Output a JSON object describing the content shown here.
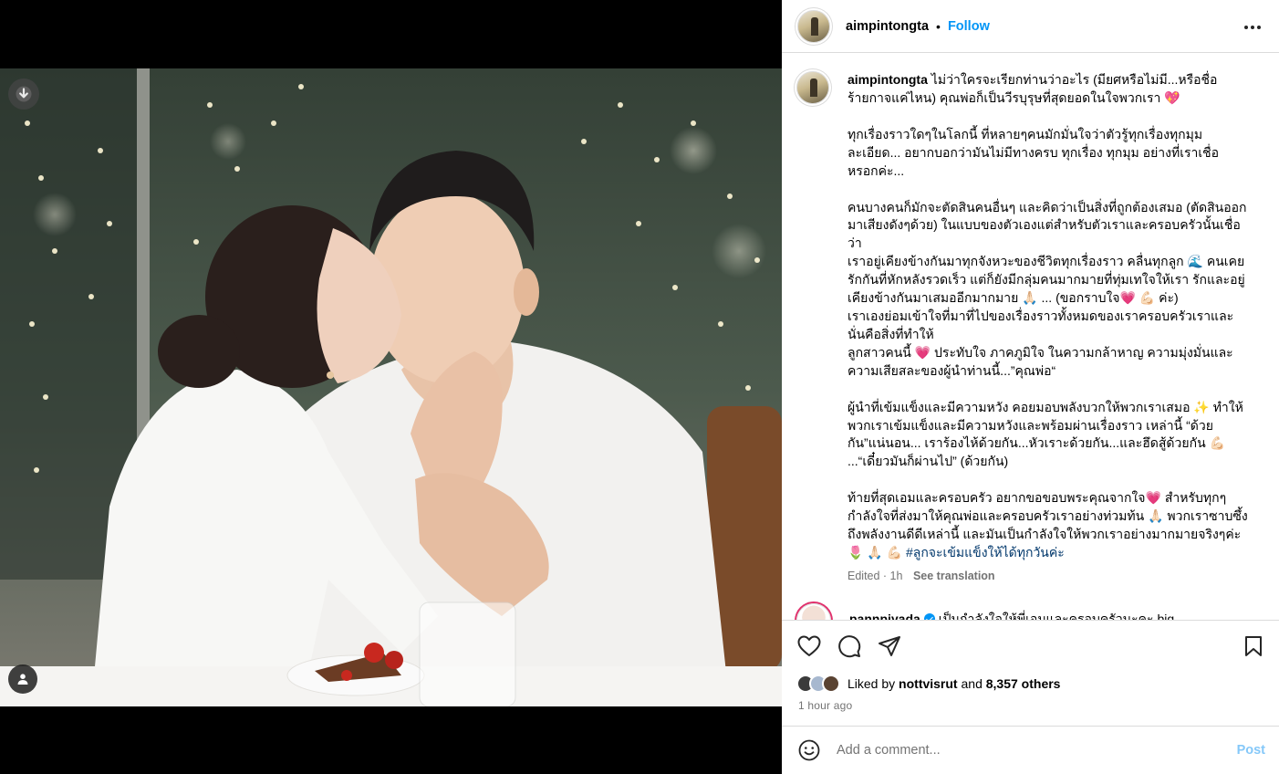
{
  "post": {
    "username": "aimpintongta",
    "follow_label": "Follow",
    "header_dot": "•",
    "caption_paragraphs": [
      "ไม่ว่าใครจะเรียกท่านว่าอะไร (มียศหรือไม่มี...หรือชื่อร้ายกาจแค่ไหน) คุณพ่อก็เป็นวีรบุรุษที่สุดยอดในใจพวกเรา 💖",
      "ทุกเรื่องราวใดๆในโลกนี้ ที่หลายๆคนมักมั่นใจว่าตัวรู้ทุกเรื่องทุกมุมละเอียด... อยากบอกว่ามันไม่มีทางครบ ทุกเรื่อง ทุกมุม อย่างที่เราเชื่อหรอกค่ะ...",
      "คนบางคนก็มักจะตัดสินคนอื่นๆ และคิดว่าเป็นสิ่งที่ถูกต้องเสมอ (ตัดสินออกมาเสียงดังๆด้วย) ในแบบของตัวเองแต่สำหรับตัวเราและครอบครัวนั้นเชื่อว่า\nเราอยู่เคียงข้างกันมาทุกจังหวะของชีวิตทุกเรื่องราว คลื่นทุกลูก 🌊 คนเคยรักกันที่หักหลังรวดเร็ว แต่ก็ยังมีกลุ่มคนมากมายที่ทุ่มเทใจให้เรา รักและอยู่เคียงข้างกันมาเสมออีกมากมาย 🙏🏻 ... (ขอกราบใจ💗 💪🏻 ค่ะ)\nเราเองย่อมเข้าใจที่มาที่ไปของเรื่องราวทั้งหมดของเราครอบครัวเราและนั่นคือสิ่งที่ทำให้\nลูกสาวคนนี้ 💗 ประทับใจ ภาคภูมิใจ ในความกล้าหาญ ความมุ่งมั่นและความเสียสละของผู้นำท่านนี้...”คุณพ่อ“",
      "ผู้นำที่เข้มแข็งและมีความหวัง คอยมอบพลังบวกให้พวกเราเสมอ ✨ ทำให้พวกเราเข้มแข็งและมีความหวังและพร้อมผ่านเรื่องราว เหล่านี้ “ด้วยกัน”แน่นอน... เราร้องไห้ด้วยกัน...หัวเราะด้วยกัน...และฮึดสู้ด้วยกัน 💪🏻 ...“เดี๋ยวมันก็ผ่านไป” (ด้วยกัน)",
      "ท้ายที่สุดเอมและครอบครัว อยากขอขอบพระคุณจากใจ💗 สำหรับทุกๆกำลังใจที่ส่งมาให้คุณพ่อและครอบครัวเราอย่างท่วมท้น 🙏🏻 พวกเราซาบซึ้งถึงพลังงานดีดีเหล่านี้ และมันเป็นกำลังใจให้พวกเราอย่างมากมายจริงๆค่ะ 🌷 🙏🏻 💪🏻"
    ],
    "hashtag": "#ลูกจะเข้มแข็งให้ได้ทุกวันค่ะ",
    "edited": "Edited · 1h",
    "see_translation": "See translation",
    "liked_by_prefix": "Liked by",
    "liked_by_user": "nottvisrut",
    "liked_by_and": "and",
    "likes_others": "8,357 others",
    "time_ago": "1 hour ago"
  },
  "comment_peek": {
    "username": "pannpiyada",
    "text": "เป็นกำลังใจให้พี่เอมและครอบครัวนะคะ big"
  },
  "add_comment": {
    "placeholder": "Add a comment...",
    "post_label": "Post"
  },
  "colors": {
    "link_blue": "#0095f6",
    "post_disabled": "#85c8f9",
    "hashtag": "#00376b",
    "muted": "#737373"
  },
  "icons": [
    "download-icon",
    "more-icon",
    "heart-icon",
    "comment-icon",
    "share-icon",
    "bookmark-icon",
    "emoji-icon",
    "tagged-user-icon"
  ]
}
